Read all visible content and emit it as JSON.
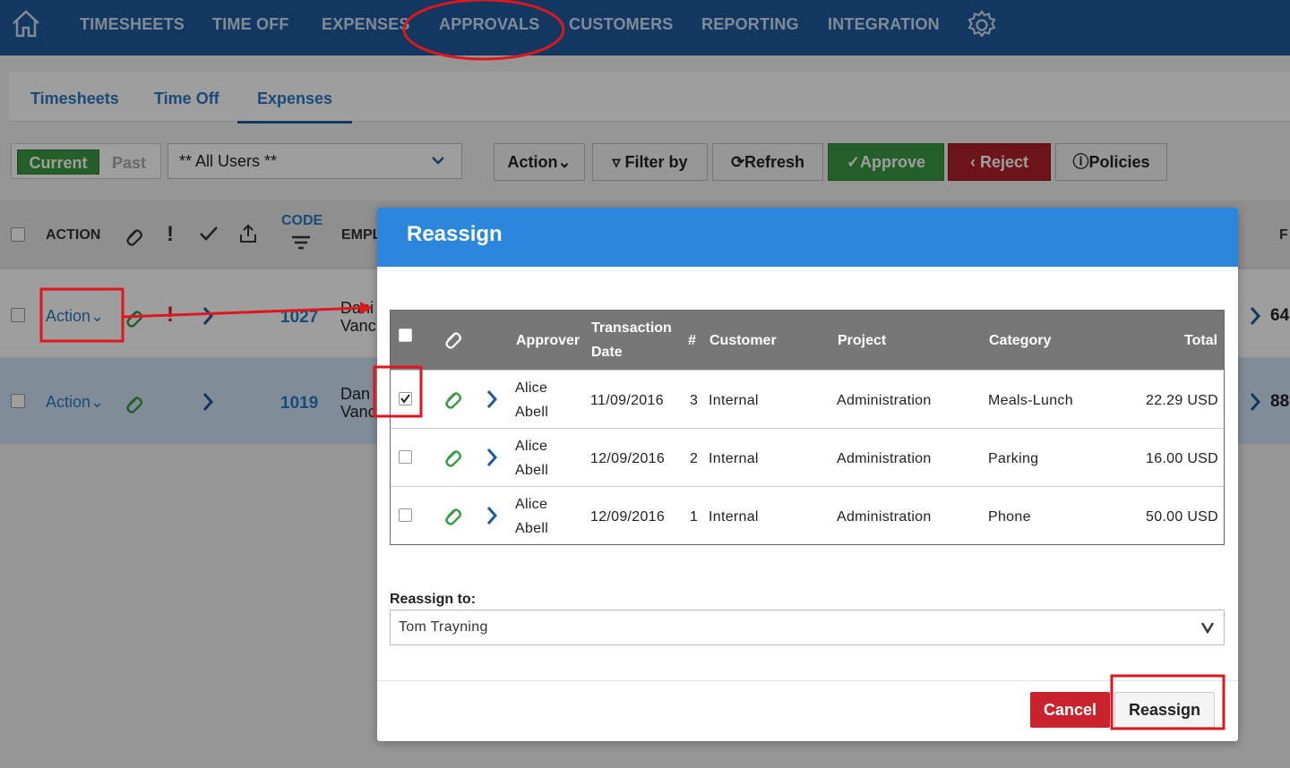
{
  "topnav": {
    "items": [
      "TIMESHEETS",
      "TIME OFF",
      "EXPENSES",
      "APPROVALS",
      "CUSTOMERS",
      "REPORTING",
      "INTEGRATION"
    ]
  },
  "subtabs": [
    "Timesheets",
    "Time Off",
    "Expenses"
  ],
  "toolbar": {
    "current": "Current",
    "past": "Past",
    "users": "** All Users **",
    "action": "Action",
    "filter": "Filter by",
    "refresh": "Refresh",
    "approve": "Approve",
    "reject": "Reject",
    "policies": "Policies"
  },
  "list": {
    "headers": {
      "action": "ACTION",
      "code": "CODE",
      "employee": "EMPL",
      "right": "F"
    },
    "rows": [
      {
        "action": "Action",
        "code": "1027",
        "emp1": "Dani",
        "emp2": "Vanc",
        "right": "64"
      },
      {
        "action": "Action",
        "code": "1019",
        "emp1": "Dan",
        "emp2": "Vanc",
        "right": "88"
      }
    ]
  },
  "modal": {
    "title": "Reassign",
    "headers": {
      "approver": "Approver",
      "date1": "Transaction",
      "date2": "Date",
      "num": "#",
      "customer": "Customer",
      "project": "Project",
      "category": "Category",
      "total": "Total"
    },
    "rows": [
      {
        "approver1": "Alice",
        "approver2": "Abell",
        "date": "11/09/2016",
        "num": "3",
        "customer": "Internal",
        "project": "Administration",
        "category": "Meals-Lunch",
        "total": "22.29 USD",
        "checked": true
      },
      {
        "approver1": "Alice",
        "approver2": "Abell",
        "date": "12/09/2016",
        "num": "2",
        "customer": "Internal",
        "project": "Administration",
        "category": "Parking",
        "total": "16.00 USD",
        "checked": false
      },
      {
        "approver1": "Alice",
        "approver2": "Abell",
        "date": "12/09/2016",
        "num": "1",
        "customer": "Internal",
        "project": "Administration",
        "category": "Phone",
        "total": "50.00 USD",
        "checked": false
      }
    ],
    "reassign_label": "Reassign to:",
    "reassign_value": "Tom Trayning",
    "cancel": "Cancel",
    "reassign_button": "Reassign"
  },
  "colors": {
    "nav": "#1d5a9c",
    "modal_header": "#2b86dd",
    "approve": "#3a9a43",
    "reject": "#b1202a",
    "annotation": "#e0161e"
  }
}
